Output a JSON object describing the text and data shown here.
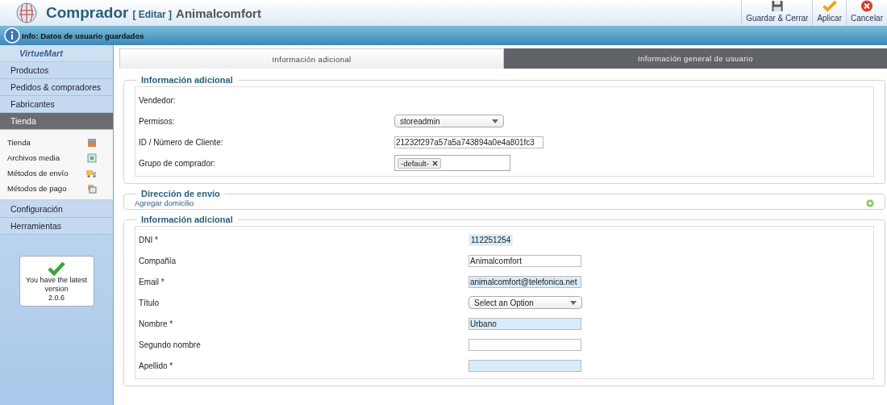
{
  "header": {
    "title": "Comprador",
    "edit_label": "[ Editar ]",
    "subtitle": "Animalcomfort"
  },
  "toolbar": [
    {
      "label": "Guardar & Cerrar",
      "kind": "save"
    },
    {
      "label": "Aplicar",
      "kind": "apply"
    },
    {
      "label": "Cancelar",
      "kind": "cancel"
    }
  ],
  "message": "Info: Datos de usuario guardados",
  "sidebar": {
    "logo": "VirtueMart",
    "menu": [
      {
        "label": "Productos",
        "selected": false
      },
      {
        "label": "Pedidos & compradores",
        "selected": false
      },
      {
        "label": "Fabricantes",
        "selected": false
      },
      {
        "label": "Tienda",
        "selected": true
      }
    ],
    "submenu": [
      {
        "label": "Tienda",
        "kind": "store"
      },
      {
        "label": "Archivos media",
        "kind": "media"
      },
      {
        "label": "Métodos de envío",
        "kind": "shipping"
      },
      {
        "label": "Métodos de pago",
        "kind": "payment"
      }
    ],
    "menu_after": [
      {
        "label": "Configuración",
        "selected": false
      },
      {
        "label": "Herramientas",
        "selected": false
      }
    ],
    "version_box": {
      "text": "You have the latest version",
      "version": "2.0.6"
    }
  },
  "tabs": [
    {
      "label": "Información adicional",
      "selected": true
    },
    {
      "label": "Información general de usuario",
      "selected": false
    }
  ],
  "section_1": {
    "legend": "Información adicional",
    "fields": [
      {
        "label": "Vendedor:",
        "kind": "none"
      },
      {
        "label": "Permisos:",
        "kind": "select",
        "value": "storeadmin"
      },
      {
        "label": "ID / Número de Cliente:",
        "kind": "text",
        "value": "21232f297a57a5a743894a0e4a801fc3",
        "highlighted": false
      },
      {
        "label": "Grupo de comprador:",
        "kind": "tags",
        "tags": [
          "-default-"
        ]
      }
    ]
  },
  "section_2": {
    "legend": "Dirección de envío",
    "link": "Agregar domicilio"
  },
  "section_3": {
    "legend": "Información adicional",
    "fields": [
      {
        "label": "DNI *",
        "kind": "short",
        "value": "112251254",
        "highlighted": true
      },
      {
        "label": "Compañía",
        "kind": "text",
        "value": "Animalcomfort",
        "highlighted": false
      },
      {
        "label": "Email *",
        "kind": "text",
        "value": "animalcomfort@telefonica.net",
        "highlighted": true
      },
      {
        "label": "Título",
        "kind": "select",
        "value": "Select an Option"
      },
      {
        "label": "Nombre *",
        "kind": "text",
        "value": "Urbano",
        "highlighted": true
      },
      {
        "label": "Segundo nombre",
        "kind": "text",
        "highlighted": false
      },
      {
        "label": "Apellido *",
        "kind": "text",
        "highlighted": true
      }
    ]
  }
}
